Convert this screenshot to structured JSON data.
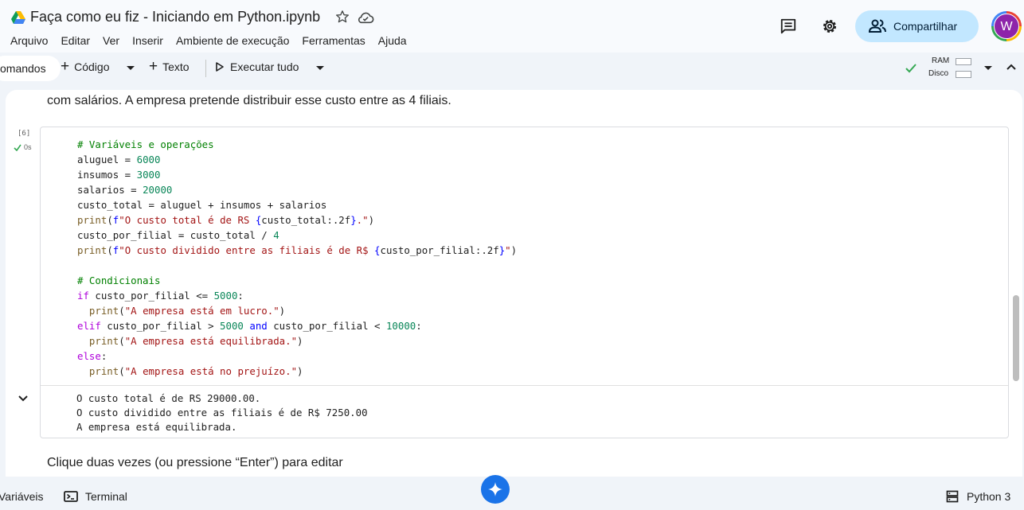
{
  "header": {
    "title": "Faça como eu fiz - Iniciando em Python.ipynb",
    "share_label": "Compartilhar",
    "avatar_letter": "W"
  },
  "menu": [
    "Arquivo",
    "Editar",
    "Ver",
    "Inserir",
    "Ambiente de execução",
    "Ferramentas",
    "Ajuda"
  ],
  "toolbar": {
    "commands_label": "omandos",
    "code_label": "Código",
    "text_label": "Texto",
    "run_all_label": "Executar tudo",
    "ram_label": "RAM",
    "disk_label": "Disco",
    "ram_level": 0.0,
    "disk_level": 0.0
  },
  "notebook": {
    "text_above": "com salários. A empresa pretende distribuir esse custo entre as 4 filiais.",
    "cell": {
      "execution_count": "[6]",
      "status": "0s",
      "code_lines": [
        [
          [
            "c-com",
            "# Variáveis e operações"
          ]
        ],
        [
          [
            "",
            "aluguel = "
          ],
          [
            "c-num",
            "6000"
          ]
        ],
        [
          [
            "",
            "insumos = "
          ],
          [
            "c-num",
            "3000"
          ]
        ],
        [
          [
            "",
            "salarios = "
          ],
          [
            "c-num",
            "20000"
          ]
        ],
        [
          [
            "",
            "custo_total = aluguel + insumos + salarios"
          ]
        ],
        [
          [
            "c-fn",
            "print"
          ],
          [
            "",
            "("
          ],
          [
            "c-fb",
            "f"
          ],
          [
            "c-str",
            "\"O custo total é de RS "
          ],
          [
            "c-fb",
            "{"
          ],
          [
            "",
            "custo_total:.2f"
          ],
          [
            "c-fb",
            "}"
          ],
          [
            "c-str",
            ".\""
          ],
          [
            "",
            ")"
          ]
        ],
        [
          [
            "",
            "custo_por_filial = custo_total / "
          ],
          [
            "c-num",
            "4"
          ]
        ],
        [
          [
            "c-fn",
            "print"
          ],
          [
            "",
            "("
          ],
          [
            "c-fb",
            "f"
          ],
          [
            "c-str",
            "\"O custo dividido entre as filiais é de R$ "
          ],
          [
            "c-fb",
            "{"
          ],
          [
            "",
            "custo_por_filial:.2f"
          ],
          [
            "c-fb",
            "}"
          ],
          [
            "c-str",
            "\""
          ],
          [
            "",
            ")"
          ]
        ],
        [
          [
            "",
            ""
          ]
        ],
        [
          [
            "c-com",
            "# Condicionais"
          ]
        ],
        [
          [
            "c-kw",
            "if"
          ],
          [
            "",
            " custo_por_filial <= "
          ],
          [
            "c-num",
            "5000"
          ],
          [
            "",
            ":"
          ]
        ],
        [
          [
            "",
            "  "
          ],
          [
            "c-fn",
            "print"
          ],
          [
            "",
            "("
          ],
          [
            "c-str",
            "\"A empresa está em lucro.\""
          ],
          [
            "",
            ")"
          ]
        ],
        [
          [
            "c-kw",
            "elif"
          ],
          [
            "",
            " custo_por_filial > "
          ],
          [
            "c-num",
            "5000"
          ],
          [
            "",
            " "
          ],
          [
            "c-kwb",
            "and"
          ],
          [
            "",
            " custo_por_filial < "
          ],
          [
            "c-num",
            "10000"
          ],
          [
            "",
            ":"
          ]
        ],
        [
          [
            "",
            "  "
          ],
          [
            "c-fn",
            "print"
          ],
          [
            "",
            "("
          ],
          [
            "c-str",
            "\"A empresa está equilibrada.\""
          ],
          [
            "",
            ")"
          ]
        ],
        [
          [
            "c-kw",
            "else"
          ],
          [
            "",
            ":"
          ]
        ],
        [
          [
            "",
            "  "
          ],
          [
            "c-fn",
            "print"
          ],
          [
            "",
            "("
          ],
          [
            "c-str",
            "\"A empresa está no prejuízo.\""
          ],
          [
            "",
            ")"
          ]
        ]
      ],
      "output_lines": [
        "O custo total é de RS 29000.00.",
        "O custo dividido entre as filiais é de R$ 7250.00",
        "A empresa está equilibrada."
      ]
    },
    "hint_text": "Clique duas vezes (ou pressione “Enter”) para editar"
  },
  "footer": {
    "variables_label": "Variáveis",
    "terminal_label": "Terminal",
    "runtime_label": "Python 3"
  },
  "colors": {
    "accent": "#1a73e8",
    "share_bg": "#c2e7ff",
    "status_ok": "#34a853",
    "avatar": "#8e24aa"
  }
}
